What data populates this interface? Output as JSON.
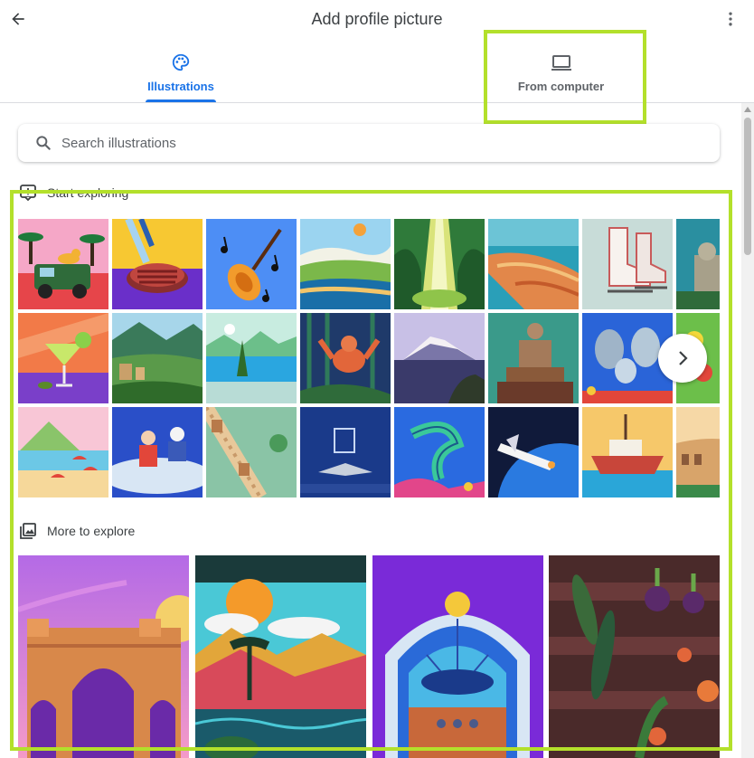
{
  "header": {
    "title": "Add profile picture",
    "back_icon": "arrow-back-icon",
    "more_icon": "more-vert-icon"
  },
  "tabs": [
    {
      "label": "Illustrations",
      "icon": "palette-icon",
      "selected": true
    },
    {
      "label": "From computer",
      "icon": "laptop-icon",
      "selected": false
    }
  ],
  "search": {
    "placeholder": "Search illustrations",
    "value": ""
  },
  "sections": {
    "start_exploring": {
      "title": "Start exploring",
      "icon": "explore-icon"
    },
    "more_to_explore": {
      "title": "More to explore",
      "icon": "photo-library-icon"
    }
  },
  "illustrations": [
    {
      "subject": "safari jeep with leopard"
    },
    {
      "subject": "steak and knife"
    },
    {
      "subject": "violin and music notes"
    },
    {
      "subject": "coastal landscape"
    },
    {
      "subject": "forest waterfall"
    },
    {
      "subject": "coastal town"
    },
    {
      "subject": "ice skates"
    },
    {
      "subject": "statue"
    },
    {
      "subject": "margarita cocktail"
    },
    {
      "subject": "mountain village"
    },
    {
      "subject": "lake and trees"
    },
    {
      "subject": "orangutan in jungle"
    },
    {
      "subject": "mountain lake"
    },
    {
      "subject": "stone statue"
    },
    {
      "subject": "manatees underwater"
    },
    {
      "subject": "flowers"
    },
    {
      "subject": "beach with umbrellas"
    },
    {
      "subject": "ice hockey players"
    },
    {
      "subject": "great wall"
    },
    {
      "subject": "shark and cage"
    },
    {
      "subject": "eel underwater"
    },
    {
      "subject": "space shuttle"
    },
    {
      "subject": "fishing boat"
    },
    {
      "subject": "colosseum"
    }
  ],
  "more_illustrations": [
    {
      "subject": "gateway monument"
    },
    {
      "subject": "sunset landscape"
    },
    {
      "subject": "jukebox"
    },
    {
      "subject": "vegetable garden"
    }
  ],
  "colors": {
    "accent": "#1a73e8",
    "highlight": "#b3e02b"
  }
}
